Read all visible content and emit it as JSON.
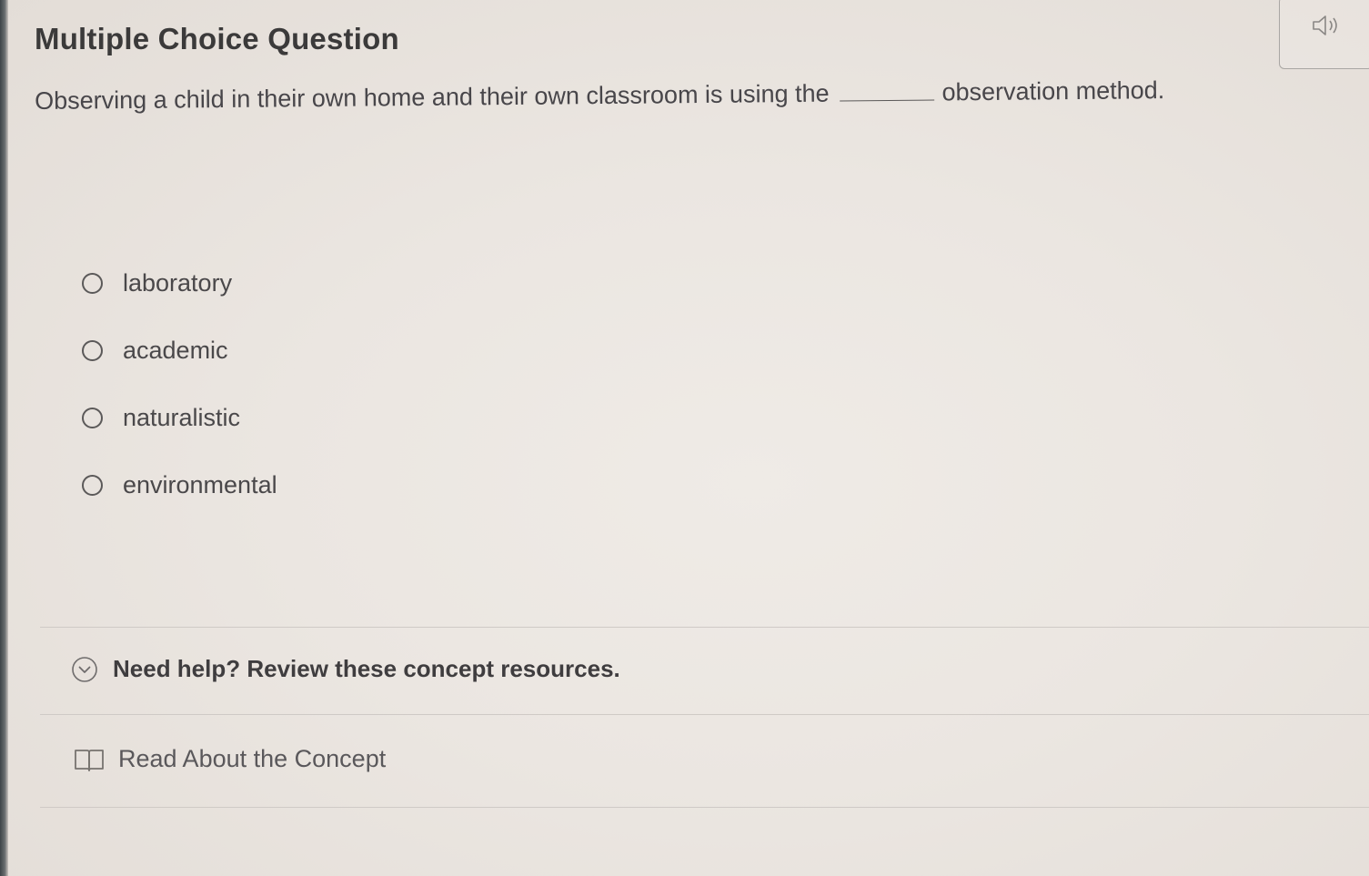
{
  "question": {
    "type_label": "Multiple Choice Question",
    "text_before": "Observing a child in their own home and their own classroom is using the",
    "text_after": "observation method."
  },
  "audio": {
    "icon": "speaker-icon"
  },
  "options": [
    {
      "label": "laboratory",
      "selected": false
    },
    {
      "label": "academic",
      "selected": false
    },
    {
      "label": "naturalistic",
      "selected": false
    },
    {
      "label": "environmental",
      "selected": false
    }
  ],
  "help": {
    "label": "Need help? Review these concept resources.",
    "icon": "chevron-circle-icon"
  },
  "concept": {
    "label": "Read About the Concept",
    "icon": "book-icon"
  }
}
